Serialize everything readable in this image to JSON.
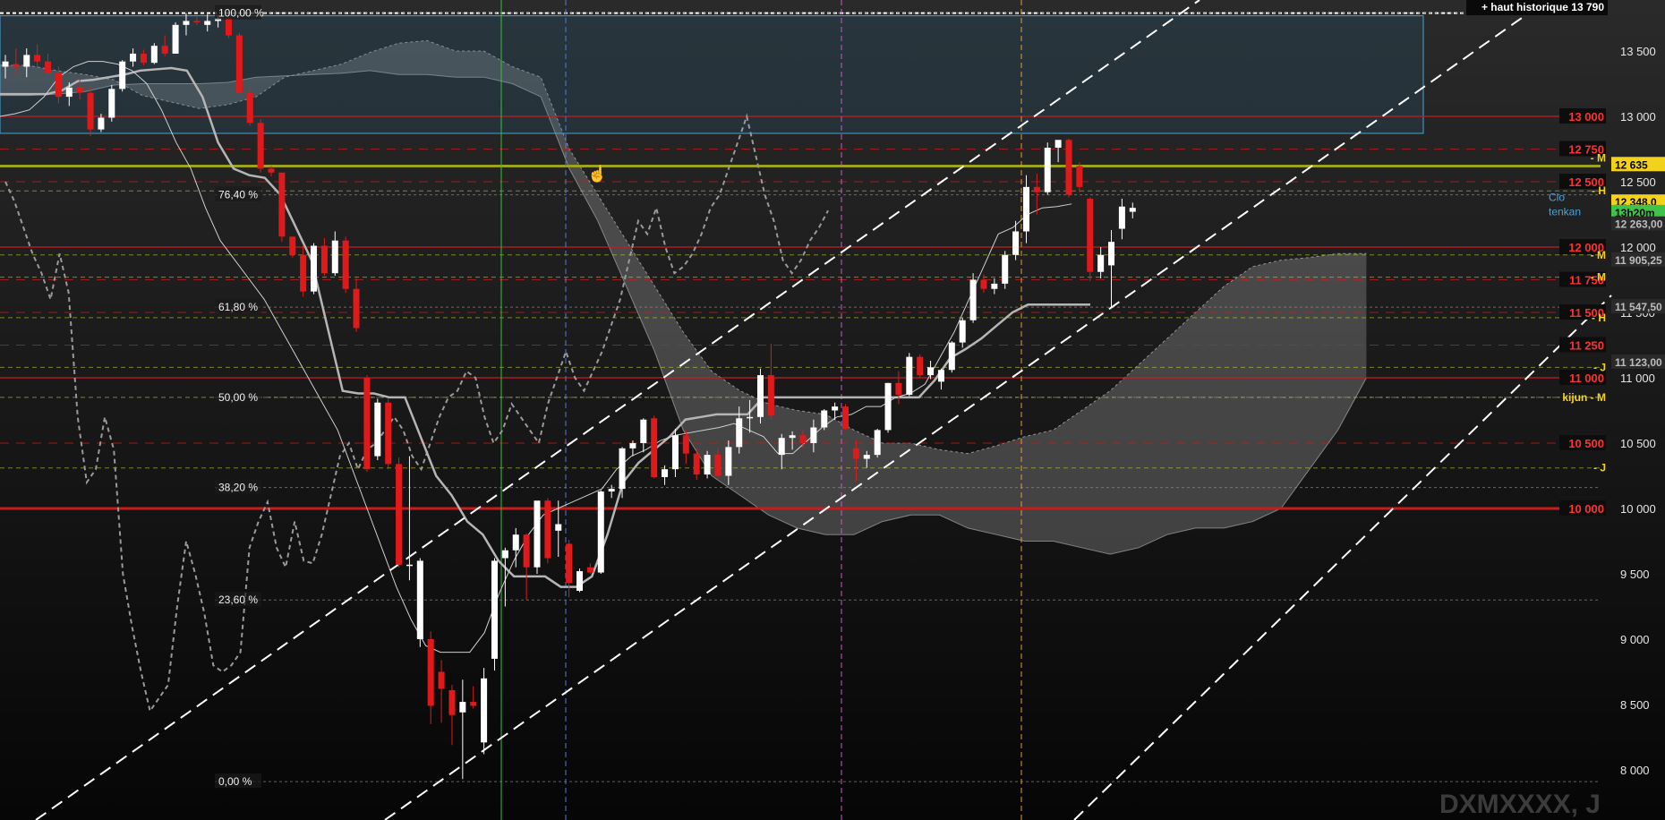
{
  "colors": {
    "background_top": "#2a2a2a",
    "background_bottom": "#060606",
    "bull_candle": "#ffffff",
    "bear_candle": "#e01a1a",
    "resistance_line": "#c81c1c",
    "fib_line": "#8a8a8a",
    "kijun_line": "#b5b5b5",
    "tenkan_line": "#cfcfcf",
    "chikou_line": "#9a9a9a",
    "cloud_fill": "#9a9a9a",
    "trend_line": "#ffffff",
    "channel_box": "#4aa3d6",
    "olive_line": "#9aa421",
    "yellow_dash": "#c8c832",
    "vline_green": "#36c236",
    "vline_blue": "#4f7bd6",
    "vline_magenta": "#c85ac8",
    "vline_orange": "#e0a030"
  },
  "chart_data": {
    "type": "candlestick",
    "title": "",
    "watermark": "DXMXXXX, J",
    "ylim": [
      7700,
      13800
    ],
    "y_ticks": [
      8000,
      8500,
      9000,
      9500,
      10000,
      10500,
      11000,
      11500,
      12000,
      12500,
      13000,
      13500
    ],
    "y_tick_labels": [
      "8 000",
      "8 500",
      "9 000",
      "9 500",
      "10 000",
      "10 500",
      "11 000",
      "11 500",
      "12 000",
      "12 500",
      "13 000",
      "13 500"
    ],
    "ath_label": "+ haut historique 13 790",
    "ath_value": 13790,
    "fib_levels": [
      {
        "label": "100,00 %",
        "value": 13790
      },
      {
        "label": "76,40 %",
        "value": 12400
      },
      {
        "label": "61,80 %",
        "value": 11540
      },
      {
        "label": "50,00 %",
        "value": 10850
      },
      {
        "label": "38,20 %",
        "value": 10160
      },
      {
        "label": "23,60 %",
        "value": 9300
      },
      {
        "label": "0,00 %",
        "value": 7910
      }
    ],
    "horizontal_levels": [
      {
        "label": "13 000",
        "value": 13000,
        "style": "solid"
      },
      {
        "label": "12 750",
        "value": 12750,
        "style": "dash"
      },
      {
        "label": "12 500",
        "value": 12500,
        "style": "dash"
      },
      {
        "label": "12 000",
        "value": 12000,
        "style": "solid"
      },
      {
        "label": "11 750",
        "value": 11750,
        "style": "dash"
      },
      {
        "label": "11 500",
        "value": 11500,
        "style": "dash"
      },
      {
        "label": "11 250",
        "value": 11250,
        "style": "dash"
      },
      {
        "label": "11 000",
        "value": 11000,
        "style": "solid"
      },
      {
        "label": "10 500",
        "value": 10500,
        "style": "dash"
      },
      {
        "label": "10 000",
        "value": 10000,
        "style": "thick"
      }
    ],
    "level_markers": [
      {
        "label": "- M",
        "value": 12680
      },
      {
        "label": "- H",
        "value": 12430
      },
      {
        "label": "- M",
        "value": 11940
      },
      {
        "label": "- M",
        "value": 11770
      },
      {
        "label": "- H",
        "value": 11460
      },
      {
        "label": "- J",
        "value": 11080
      },
      {
        "label": "kijun - M",
        "value": 10850
      },
      {
        "label": "- J",
        "value": 10310
      }
    ],
    "price_tags": [
      {
        "label": "12 635",
        "value": 12635,
        "bg": "#f2d21c",
        "fg": "#000000"
      },
      {
        "label": "12 348,0",
        "value": 12348,
        "bg": "#f2d21c",
        "fg": "#000000"
      },
      {
        "label": "13h20m",
        "value": 12268,
        "bg": "#3fc34a",
        "fg": "#000000"
      },
      {
        "label": "12 263,00",
        "value": 12180,
        "bg": "#2a2a2a",
        "fg": "#bdbdbd"
      },
      {
        "label": "11 905,25",
        "value": 11905,
        "bg": "#2a2a2a",
        "fg": "#bdbdbd"
      },
      {
        "label": "11 547,50",
        "value": 11547,
        "bg": "#2a2a2a",
        "fg": "#bdbdbd"
      },
      {
        "label": "11 123,00",
        "value": 11123,
        "bg": "#2a2a2a",
        "fg": "#bdbdbd"
      }
    ],
    "inline_labels": [
      {
        "label": "tenkan",
        "value": 12270
      },
      {
        "label": "Clo",
        "value": 12380
      }
    ],
    "candles": [
      {
        "o": 13380,
        "h": 13470,
        "l": 13290,
        "c": 13420
      },
      {
        "o": 13400,
        "h": 13520,
        "l": 13320,
        "c": 13380
      },
      {
        "o": 13380,
        "h": 13520,
        "l": 13300,
        "c": 13470
      },
      {
        "o": 13470,
        "h": 13550,
        "l": 13380,
        "c": 13420
      },
      {
        "o": 13420,
        "h": 13480,
        "l": 13300,
        "c": 13330
      },
      {
        "o": 13330,
        "h": 13380,
        "l": 13100,
        "c": 13150
      },
      {
        "o": 13150,
        "h": 13260,
        "l": 13080,
        "c": 13220
      },
      {
        "o": 13220,
        "h": 13280,
        "l": 13130,
        "c": 13180
      },
      {
        "o": 13180,
        "h": 13230,
        "l": 12850,
        "c": 12900
      },
      {
        "o": 12900,
        "h": 13020,
        "l": 12880,
        "c": 12990
      },
      {
        "o": 12990,
        "h": 13240,
        "l": 12960,
        "c": 13210
      },
      {
        "o": 13210,
        "h": 13430,
        "l": 13190,
        "c": 13420
      },
      {
        "o": 13420,
        "h": 13520,
        "l": 13380,
        "c": 13480
      },
      {
        "o": 13480,
        "h": 13510,
        "l": 13390,
        "c": 13410
      },
      {
        "o": 13410,
        "h": 13560,
        "l": 13400,
        "c": 13540
      },
      {
        "o": 13540,
        "h": 13620,
        "l": 13460,
        "c": 13480
      },
      {
        "o": 13480,
        "h": 13720,
        "l": 13480,
        "c": 13700
      },
      {
        "o": 13700,
        "h": 13790,
        "l": 13620,
        "c": 13730
      },
      {
        "o": 13730,
        "h": 13760,
        "l": 13700,
        "c": 13720
      },
      {
        "o": 13700,
        "h": 13780,
        "l": 13650,
        "c": 13730
      },
      {
        "o": 13730,
        "h": 13770,
        "l": 13680,
        "c": 13750
      },
      {
        "o": 13750,
        "h": 13760,
        "l": 13600,
        "c": 13620
      },
      {
        "o": 13620,
        "h": 13640,
        "l": 13170,
        "c": 13180
      },
      {
        "o": 13180,
        "h": 13220,
        "l": 12930,
        "c": 12950
      },
      {
        "o": 12950,
        "h": 12980,
        "l": 12570,
        "c": 12600
      },
      {
        "o": 12600,
        "h": 12620,
        "l": 12540,
        "c": 12570
      },
      {
        "o": 12570,
        "h": 12560,
        "l": 12040,
        "c": 12080
      },
      {
        "o": 12080,
        "h": 12080,
        "l": 11920,
        "c": 11940
      },
      {
        "o": 11940,
        "h": 12020,
        "l": 11620,
        "c": 11660
      },
      {
        "o": 11660,
        "h": 12030,
        "l": 11640,
        "c": 12010
      },
      {
        "o": 12010,
        "h": 12070,
        "l": 11780,
        "c": 11800
      },
      {
        "o": 11800,
        "h": 12120,
        "l": 11780,
        "c": 12050
      },
      {
        "o": 12050,
        "h": 12080,
        "l": 11650,
        "c": 11680
      },
      {
        "o": 11680,
        "h": 11760,
        "l": 11350,
        "c": 11380
      },
      {
        "o": 11000,
        "h": 11020,
        "l": 10280,
        "c": 10300
      },
      {
        "o": 10400,
        "h": 10840,
        "l": 10370,
        "c": 10810
      },
      {
        "o": 10810,
        "h": 10840,
        "l": 10300,
        "c": 10340
      },
      {
        "o": 10340,
        "h": 10390,
        "l": 9550,
        "c": 9570
      },
      {
        "o": 9570,
        "h": 10400,
        "l": 9450,
        "c": 9570
      },
      {
        "o": 9000,
        "h": 9620,
        "l": 8940,
        "c": 9600
      },
      {
        "o": 9000,
        "h": 9060,
        "l": 8350,
        "c": 8490
      },
      {
        "o": 8750,
        "h": 8840,
        "l": 8360,
        "c": 8620
      },
      {
        "o": 8610,
        "h": 8650,
        "l": 8190,
        "c": 8420
      },
      {
        "o": 8440,
        "h": 8690,
        "l": 7930,
        "c": 8520
      },
      {
        "o": 8520,
        "h": 8640,
        "l": 8470,
        "c": 8490
      },
      {
        "o": 8210,
        "h": 8780,
        "l": 8120,
        "c": 8700
      },
      {
        "o": 8850,
        "h": 9620,
        "l": 8760,
        "c": 9600
      },
      {
        "o": 9620,
        "h": 9700,
        "l": 9250,
        "c": 9680
      },
      {
        "o": 9680,
        "h": 9850,
        "l": 9550,
        "c": 9800
      },
      {
        "o": 9800,
        "h": 9810,
        "l": 9300,
        "c": 9550
      },
      {
        "o": 9550,
        "h": 10050,
        "l": 9500,
        "c": 10060
      },
      {
        "o": 10060,
        "h": 10080,
        "l": 9580,
        "c": 9620
      },
      {
        "o": 9830,
        "h": 10060,
        "l": 9630,
        "c": 9880
      },
      {
        "o": 9730,
        "h": 9760,
        "l": 9320,
        "c": 9430
      },
      {
        "o": 9370,
        "h": 9540,
        "l": 9360,
        "c": 9520
      },
      {
        "o": 9550,
        "h": 9580,
        "l": 9500,
        "c": 9510
      },
      {
        "o": 9510,
        "h": 10140,
        "l": 9500,
        "c": 10130
      },
      {
        "o": 10130,
        "h": 10180,
        "l": 10080,
        "c": 10150
      },
      {
        "o": 10150,
        "h": 10470,
        "l": 10080,
        "c": 10460
      },
      {
        "o": 10460,
        "h": 10520,
        "l": 10400,
        "c": 10500
      },
      {
        "o": 10500,
        "h": 10690,
        "l": 10430,
        "c": 10680
      },
      {
        "o": 10690,
        "h": 10710,
        "l": 10230,
        "c": 10240
      },
      {
        "o": 10240,
        "h": 10330,
        "l": 10180,
        "c": 10300
      },
      {
        "o": 10300,
        "h": 10610,
        "l": 10240,
        "c": 10560
      },
      {
        "o": 10560,
        "h": 10600,
        "l": 10340,
        "c": 10420
      },
      {
        "o": 10420,
        "h": 10460,
        "l": 10220,
        "c": 10260
      },
      {
        "o": 10260,
        "h": 10440,
        "l": 10230,
        "c": 10410
      },
      {
        "o": 10410,
        "h": 10460,
        "l": 10230,
        "c": 10250
      },
      {
        "o": 10250,
        "h": 10520,
        "l": 10180,
        "c": 10470
      },
      {
        "o": 10470,
        "h": 10780,
        "l": 10420,
        "c": 10690
      },
      {
        "o": 10690,
        "h": 10830,
        "l": 10580,
        "c": 10700
      },
      {
        "o": 10700,
        "h": 11070,
        "l": 10650,
        "c": 11020
      },
      {
        "o": 11020,
        "h": 11260,
        "l": 10680,
        "c": 10710
      },
      {
        "o": 10410,
        "h": 10570,
        "l": 10300,
        "c": 10540
      },
      {
        "o": 10540,
        "h": 10590,
        "l": 10450,
        "c": 10560
      },
      {
        "o": 10560,
        "h": 10600,
        "l": 10460,
        "c": 10500
      },
      {
        "o": 10500,
        "h": 10680,
        "l": 10430,
        "c": 10620
      },
      {
        "o": 10620,
        "h": 10760,
        "l": 10600,
        "c": 10750
      },
      {
        "o": 10750,
        "h": 10810,
        "l": 10680,
        "c": 10780
      },
      {
        "o": 10780,
        "h": 10800,
        "l": 10600,
        "c": 10610
      },
      {
        "o": 10460,
        "h": 10520,
        "l": 10210,
        "c": 10380
      },
      {
        "o": 10380,
        "h": 10440,
        "l": 10310,
        "c": 10410
      },
      {
        "o": 10410,
        "h": 10610,
        "l": 10390,
        "c": 10600
      },
      {
        "o": 10600,
        "h": 10960,
        "l": 10580,
        "c": 10960
      },
      {
        "o": 10960,
        "h": 11050,
        "l": 10800,
        "c": 10870
      },
      {
        "o": 10870,
        "h": 11190,
        "l": 10860,
        "c": 11160
      },
      {
        "o": 11160,
        "h": 11180,
        "l": 11000,
        "c": 11020
      },
      {
        "o": 11020,
        "h": 11130,
        "l": 10990,
        "c": 11080
      },
      {
        "o": 10970,
        "h": 11070,
        "l": 10910,
        "c": 11060
      },
      {
        "o": 11060,
        "h": 11280,
        "l": 11040,
        "c": 11270
      },
      {
        "o": 11270,
        "h": 11460,
        "l": 11230,
        "c": 11440
      },
      {
        "o": 11440,
        "h": 11800,
        "l": 11420,
        "c": 11750
      },
      {
        "o": 11750,
        "h": 11790,
        "l": 11650,
        "c": 11680
      },
      {
        "o": 11680,
        "h": 11760,
        "l": 11640,
        "c": 11720
      },
      {
        "o": 11720,
        "h": 11970,
        "l": 11680,
        "c": 11940
      },
      {
        "o": 11940,
        "h": 12200,
        "l": 11900,
        "c": 12120
      },
      {
        "o": 12120,
        "h": 12550,
        "l": 12030,
        "c": 12460
      },
      {
        "o": 12460,
        "h": 12560,
        "l": 12250,
        "c": 12420
      },
      {
        "o": 12420,
        "h": 12800,
        "l": 12400,
        "c": 12760
      },
      {
        "o": 12760,
        "h": 12800,
        "l": 12650,
        "c": 12820
      },
      {
        "o": 12820,
        "h": 12830,
        "l": 12380,
        "c": 12400
      },
      {
        "o": 12620,
        "h": 12650,
        "l": 12420,
        "c": 12460
      },
      {
        "o": 12370,
        "h": 12380,
        "l": 11740,
        "c": 11810
      },
      {
        "o": 11810,
        "h": 12000,
        "l": 11760,
        "c": 11940
      },
      {
        "o": 11860,
        "h": 12130,
        "l": 11530,
        "c": 12040
      },
      {
        "o": 12140,
        "h": 12370,
        "l": 12060,
        "c": 12310
      },
      {
        "o": 12270,
        "h": 12340,
        "l": 12220,
        "c": 12300
      }
    ],
    "tenkan": [
      13000,
      13020,
      13050,
      13150,
      13300,
      13380,
      13420,
      13420,
      13400,
      13350,
      13250,
      13050,
      12800,
      12600,
      12300,
      12050,
      11900,
      11750,
      11600,
      11400,
      11200,
      11000,
      10800,
      10600,
      10300,
      10000,
      9700,
      9400,
      9150,
      8950,
      8900,
      8900,
      8900,
      9050,
      9350,
      9600,
      9800,
      9950,
      10000,
      10050,
      10100,
      10150,
      10300,
      10400,
      10450,
      10520,
      10560,
      10580,
      10600,
      10620,
      10650,
      10600,
      10550,
      10420,
      10420,
      10520,
      10620,
      10700,
      10720,
      10780,
      10780,
      10850,
      10880,
      10950,
      11150,
      11350,
      11600,
      11850,
      12100,
      12150,
      12250,
      12300,
      12310,
      12330
    ],
    "kijun": [
      13170,
      13170,
      13170,
      13170,
      13200,
      13270,
      13280,
      13300,
      13320,
      13350,
      13360,
      13370,
      13350,
      13150,
      12800,
      12600,
      12550,
      12530,
      12400,
      12150,
      11900,
      11400,
      10900,
      10880,
      10880,
      10850,
      10850,
      10550,
      10250,
      10100,
      9900,
      9800,
      9600,
      9480,
      9480,
      9480,
      9400,
      9400,
      9480,
      9800,
      10200,
      10350,
      10450,
      10550,
      10680,
      10700,
      10720,
      10720,
      10720,
      10850,
      10850,
      10850,
      10850,
      10850,
      10850,
      10850,
      10850,
      10850,
      10850,
      10850,
      10980,
      11150,
      11220,
      11300,
      11400,
      11500,
      11560,
      11560,
      11560,
      11560,
      11560
    ],
    "senkou_a": [
      13390,
      13390,
      13350,
      13320,
      13280,
      13160,
      13110,
      13060,
      13090,
      13150,
      13300,
      13350,
      13400,
      13490,
      13560,
      13580,
      13500,
      13500,
      13380,
      13300,
      12750,
      12400,
      12050,
      11700,
      11350,
      11050,
      10900,
      10800,
      10750,
      10720,
      10600,
      10500,
      10500,
      10450,
      10420,
      10480,
      10550,
      10600,
      10750,
      10900,
      11100,
      11300,
      11500,
      11700,
      11850,
      11900,
      11920,
      11950,
      11950
    ],
    "senkou_b": [
      13160,
      13160,
      13170,
      13190,
      13240,
      13250,
      13250,
      13250,
      13260,
      13300,
      13310,
      13320,
      13330,
      13350,
      13320,
      13320,
      13300,
      13300,
      13250,
      13150,
      12600,
      12200,
      11700,
      11200,
      10600,
      10250,
      10100,
      9950,
      9850,
      9800,
      9800,
      9900,
      9950,
      9950,
      9850,
      9800,
      9750,
      9750,
      9700,
      9650,
      9700,
      9800,
      9850,
      9850,
      9900,
      10000,
      10300,
      10600,
      11000,
      11050,
      11050
    ],
    "chikou": [
      12500,
      12350,
      12150,
      11950,
      11800,
      11600,
      11950,
      11650,
      10700,
      10200,
      10300,
      10700,
      10450,
      9500,
      9100,
      8750,
      8450,
      8550,
      8650,
      9250,
      9750,
      9500,
      9200,
      8800,
      8750,
      8800,
      8900,
      9700,
      9900,
      10050,
      9700,
      9550,
      9900,
      9600,
      9580,
      9800,
      10100,
      10400,
      10500,
      10300,
      10450,
      10500,
      10600,
      10700,
      10600,
      10400,
      10300,
      10500,
      10700,
      10850,
      10900,
      11050,
      11000,
      10700,
      10500,
      10600,
      10800,
      10700,
      10600,
      10500,
      10800,
      11000,
      11200,
      11000,
      10900,
      11050,
      11200,
      11400,
      11600,
      11900,
      12200,
      12100,
      12300,
      12000,
      11800,
      11850,
      11950,
      12100,
      12300,
      12400,
      12600,
      12800,
      13000,
      12700,
      12400,
      12200,
      11900,
      11800,
      11900,
      12050,
      12150,
      12280
    ]
  }
}
